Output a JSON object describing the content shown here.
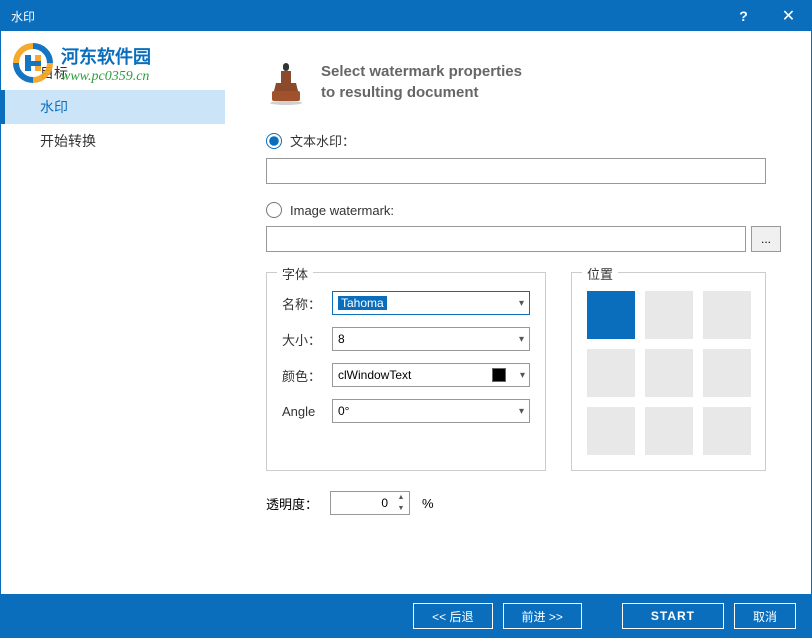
{
  "title": "水印",
  "sidebar": {
    "items": [
      {
        "label": "目标"
      },
      {
        "label": "水印"
      },
      {
        "label": "开始转换"
      }
    ],
    "active_index": 1
  },
  "watermark_overlay": {
    "title": "河东软件园",
    "url": "www.pc0359.cn"
  },
  "header": {
    "line1": "Select watermark properties",
    "line2": "to resulting document"
  },
  "options": {
    "text_label": "文本水印：",
    "text_value": "",
    "image_label": "Image watermark:",
    "image_value": "",
    "browse_label": "...",
    "selected": "text"
  },
  "font_panel": {
    "legend": "字体",
    "name_label": "名称：",
    "name_value": "Tahoma",
    "size_label": "大小：",
    "size_value": "8",
    "color_label": "颜色：",
    "color_value": "clWindowText",
    "angle_label": "Angle",
    "angle_value": "0°"
  },
  "position_panel": {
    "legend": "位置",
    "active_index": 0
  },
  "opacity": {
    "label": "透明度：",
    "value": "0",
    "suffix": "%"
  },
  "footer": {
    "back": "<< 后退",
    "forward": "前进 >>",
    "start": "START",
    "cancel": "取消"
  }
}
